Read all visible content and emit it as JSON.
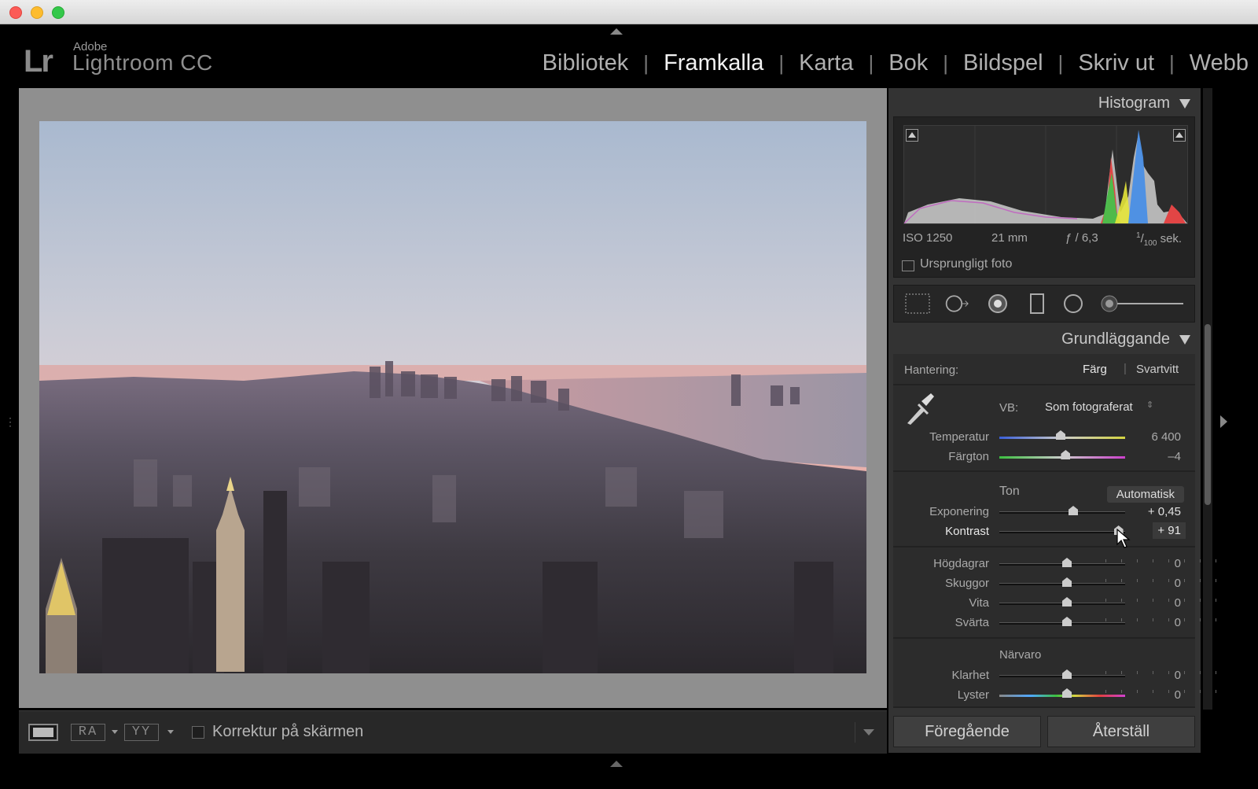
{
  "app": {
    "brand_short": "Lr",
    "brand_vendor": "Adobe",
    "brand_product": "Lightroom CC"
  },
  "modules": [
    {
      "label": "Bibliotek",
      "active": false
    },
    {
      "label": "Framkalla",
      "active": true
    },
    {
      "label": "Karta",
      "active": false
    },
    {
      "label": "Bok",
      "active": false
    },
    {
      "label": "Bildspel",
      "active": false
    },
    {
      "label": "Skriv ut",
      "active": false
    },
    {
      "label": "Webb",
      "active": false
    }
  ],
  "module_separator": "|",
  "toolbar": {
    "ra_label": "RA",
    "yy_label": "YY",
    "softproof_label": "Korrektur på skärmen",
    "softproof_checked": false
  },
  "histogram": {
    "title": "Histogram",
    "iso": "ISO 1250",
    "focal": "21 mm",
    "aperture": "ƒ / 6,3",
    "shutter_num": "1",
    "shutter_den": "100",
    "shutter_unit": "sek.",
    "original_label": "Ursprungligt foto"
  },
  "basic": {
    "title": "Grundläggande",
    "treatment_label": "Hantering:",
    "treatment_color": "Färg",
    "treatment_bw": "Svartvitt",
    "wb_label": "VB:",
    "wb_value": "Som fotograferat",
    "tone_label": "Ton",
    "auto_label": "Automatisk",
    "presence_label": "Närvaro",
    "sliders": {
      "temperature": {
        "label": "Temperatur",
        "value": "6 400",
        "pos": 0.45
      },
      "tint": {
        "label": "Färgton",
        "value": "–4",
        "pos": 0.49
      },
      "exposure": {
        "label": "Exponering",
        "value": "+ 0,45",
        "pos": 0.55
      },
      "contrast": {
        "label": "Kontrast",
        "value": "+ 91",
        "pos": 0.91
      },
      "highlights": {
        "label": "Högdagrar",
        "value": "0",
        "pos": 0.5
      },
      "shadows": {
        "label": "Skuggor",
        "value": "0",
        "pos": 0.5
      },
      "whites": {
        "label": "Vita",
        "value": "0",
        "pos": 0.5
      },
      "blacks": {
        "label": "Svärta",
        "value": "0",
        "pos": 0.5
      },
      "clarity": {
        "label": "Klarhet",
        "value": "0",
        "pos": 0.5
      },
      "vibrance": {
        "label": "Lyster",
        "value": "0",
        "pos": 0.5
      }
    }
  },
  "buttons": {
    "previous": "Föregående",
    "reset": "Återställ"
  },
  "colors": {
    "accent_active": "#f2f2f2",
    "panel_bg": "#333333",
    "workspace_bg": "#8f8f8f"
  }
}
